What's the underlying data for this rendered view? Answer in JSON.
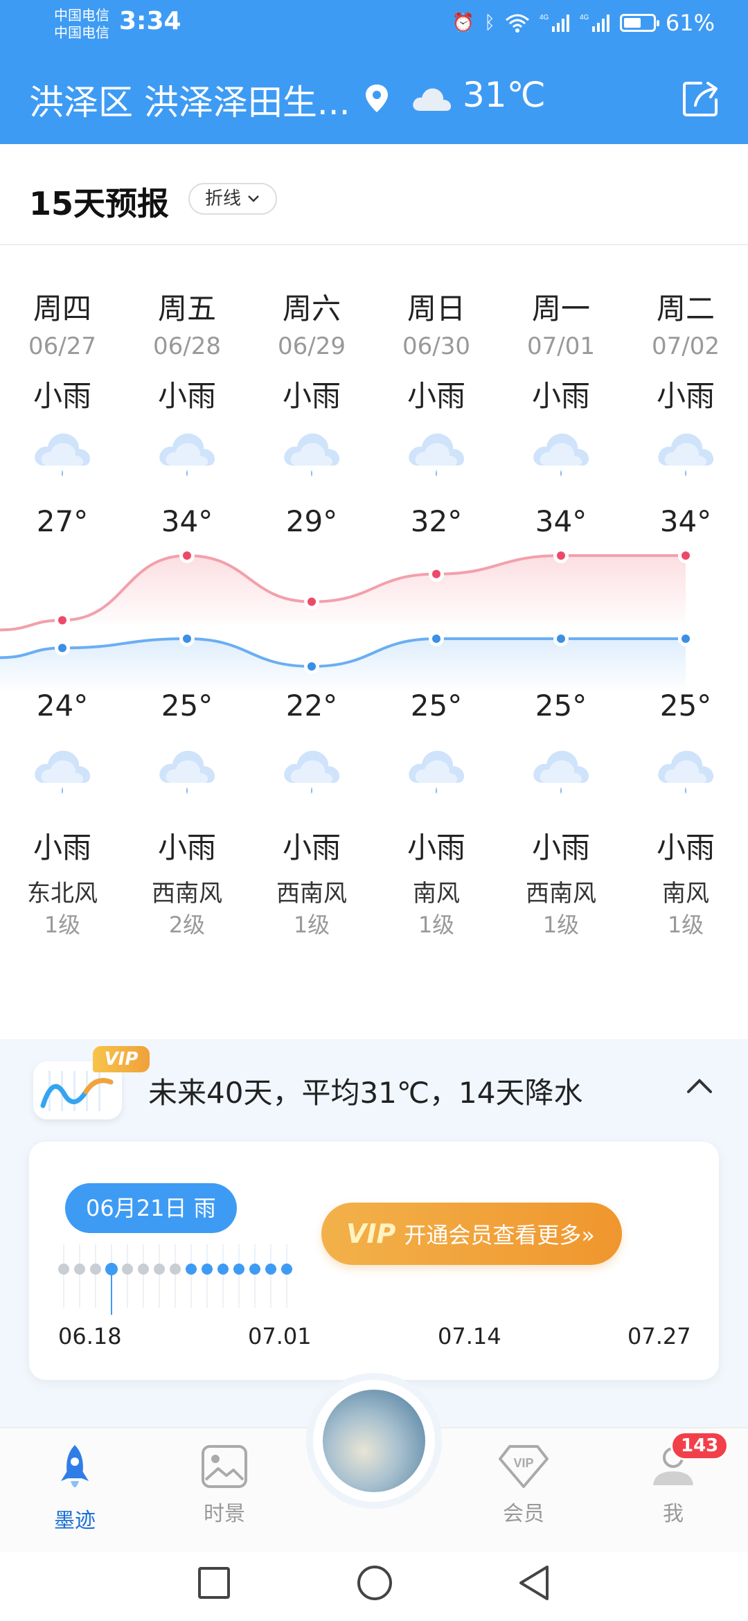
{
  "status_bar": {
    "carrier1": "中国电信",
    "carrier2": "中国电信",
    "time": "3:34",
    "battery": "61%",
    "battery_level": 0.61
  },
  "header": {
    "location": "洪泽区 洪泽泽田生...",
    "temperature": "31℃"
  },
  "forecast": {
    "title": "15天预报",
    "mode_label": "折线",
    "days": [
      {
        "day": "周四",
        "date": "06/27",
        "weather_day": "小雨",
        "high": "27°",
        "low": "24°",
        "weather_night": "小雨",
        "wind": "东北风",
        "level": "1级"
      },
      {
        "day": "周五",
        "date": "06/28",
        "weather_day": "小雨",
        "high": "34°",
        "low": "25°",
        "weather_night": "小雨",
        "wind": "西南风",
        "level": "2级"
      },
      {
        "day": "周六",
        "date": "06/29",
        "weather_day": "小雨",
        "high": "29°",
        "low": "22°",
        "weather_night": "小雨",
        "wind": "西南风",
        "level": "1级"
      },
      {
        "day": "周日",
        "date": "06/30",
        "weather_day": "小雨",
        "high": "32°",
        "low": "25°",
        "weather_night": "小雨",
        "wind": "南风",
        "level": "1级"
      },
      {
        "day": "周一",
        "date": "07/01",
        "weather_day": "小雨",
        "high": "34°",
        "low": "25°",
        "weather_night": "小雨",
        "wind": "西南风",
        "level": "1级"
      },
      {
        "day": "周二",
        "date": "07/02",
        "weather_day": "小雨",
        "high": "34°",
        "low": "25°",
        "weather_night": "小雨",
        "wind": "南风",
        "level": "1级"
      }
    ]
  },
  "forecast40": {
    "vip_tag": "VIP",
    "summary": "未来40天，平均31℃，14天降水",
    "selected_date": "06月21日 雨",
    "vip_button_mark": "VIP",
    "vip_button_label": "开通会员查看更多»",
    "axis_labels": [
      "06.18",
      "07.01",
      "07.14",
      "07.27"
    ]
  },
  "bottom_nav": {
    "items": [
      {
        "label": "墨迹",
        "active": true
      },
      {
        "label": "时景",
        "active": false
      },
      {
        "label": "会员",
        "active": false
      },
      {
        "label": "我",
        "active": false
      }
    ],
    "badge": "143"
  },
  "colors": {
    "header_bg": "#3e9bf4",
    "high_line": "#f06a7a",
    "low_line": "#4b9cf0",
    "vip_orange": "#f0962e",
    "active_nav": "#1a6fd6"
  }
}
